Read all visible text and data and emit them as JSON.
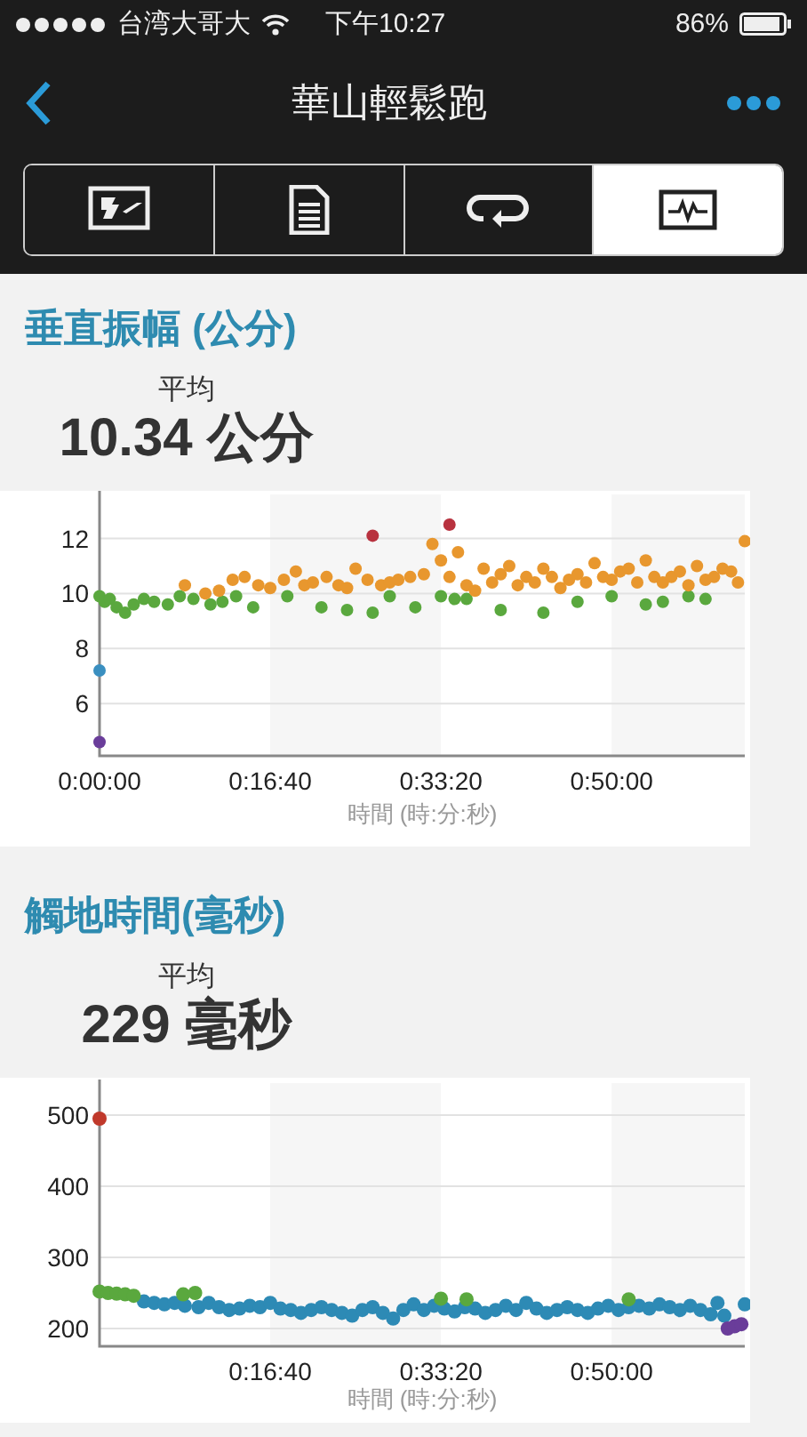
{
  "status_bar": {
    "carrier": "台湾大哥大",
    "time": "下午10:27",
    "battery": "86%"
  },
  "nav": {
    "title": "華山輕鬆跑"
  },
  "tabs": [
    {
      "selected": false
    },
    {
      "selected": false
    },
    {
      "selected": false
    },
    {
      "selected": true
    }
  ],
  "sections": [
    {
      "title": "垂直振幅 (公分)",
      "average_label": "平均",
      "average_value": "10.34 公分",
      "chart_data": {
        "type": "scatter",
        "xlabel": "時間 (時:分:秒)",
        "xlim": [
          0,
          3780
        ],
        "ylim": [
          4.1,
          13.6
        ],
        "xticks": [
          {
            "value": 0,
            "label": "0:00:00"
          },
          {
            "value": 1000,
            "label": "0:16:40"
          },
          {
            "value": 2000,
            "label": "0:33:20"
          },
          {
            "value": 3000,
            "label": "0:50:00"
          }
        ],
        "yticks": [
          6,
          8,
          10,
          12
        ],
        "grid": true,
        "series": [
          {
            "color": "#5aa83e",
            "x": [
              0,
              30,
              60,
              100,
              150,
              200,
              260,
              320,
              400,
              470,
              550,
              650,
              720,
              800,
              900,
              1100,
              1300,
              1450,
              1600,
              1700,
              1850,
              2000,
              2080,
              2150,
              2350,
              2600,
              2800,
              3000,
              3200,
              3300,
              3450,
              3550
            ],
            "values": [
              9.9,
              9.7,
              9.8,
              9.5,
              9.3,
              9.6,
              9.8,
              9.7,
              9.6,
              9.9,
              9.8,
              9.6,
              9.7,
              9.9,
              9.5,
              9.9,
              9.5,
              9.4,
              9.3,
              9.9,
              9.5,
              9.9,
              9.8,
              9.8,
              9.4,
              9.3,
              9.7,
              9.9,
              9.6,
              9.7,
              9.9,
              9.8
            ]
          },
          {
            "color": "#e8972e",
            "x": [
              500,
              620,
              700,
              780,
              850,
              930,
              1000,
              1080,
              1150,
              1200,
              1250,
              1330,
              1400,
              1450,
              1500,
              1570,
              1650,
              1700,
              1750,
              1820,
              1900,
              1950,
              2000,
              2050,
              2100,
              2150,
              2200,
              2250,
              2300,
              2350,
              2400,
              2450,
              2500,
              2550,
              2600,
              2650,
              2700,
              2750,
              2800,
              2850,
              2900,
              2950,
              3000,
              3050,
              3100,
              3150,
              3200,
              3250,
              3300,
              3350,
              3400,
              3450,
              3500,
              3550,
              3600,
              3650,
              3700,
              3740,
              3780
            ],
            "values": [
              10.3,
              10.0,
              10.1,
              10.5,
              10.6,
              10.3,
              10.2,
              10.5,
              10.8,
              10.3,
              10.4,
              10.6,
              10.3,
              10.2,
              10.9,
              10.5,
              10.3,
              10.4,
              10.5,
              10.6,
              10.7,
              11.8,
              11.2,
              10.6,
              11.5,
              10.3,
              10.1,
              10.9,
              10.4,
              10.7,
              11.0,
              10.3,
              10.6,
              10.4,
              10.9,
              10.6,
              10.2,
              10.5,
              10.7,
              10.4,
              11.1,
              10.6,
              10.5,
              10.8,
              10.9,
              10.4,
              11.2,
              10.6,
              10.4,
              10.6,
              10.8,
              10.3,
              11.0,
              10.5,
              10.6,
              10.9,
              10.8,
              10.4,
              11.9
            ]
          },
          {
            "color": "#b8323f",
            "x": [
              1600,
              2050
            ],
            "values": [
              12.1,
              12.5
            ]
          },
          {
            "color": "#3a8fc0",
            "x": [
              0
            ],
            "values": [
              7.2
            ]
          },
          {
            "color": "#6a3d9a",
            "x": [
              0
            ],
            "values": [
              4.6
            ]
          }
        ]
      }
    },
    {
      "title": "觸地時間(毫秒)",
      "average_label": "平均",
      "average_value": "229 毫秒",
      "chart_data": {
        "type": "scatter",
        "xlabel": "時間 (時:分:秒)",
        "xlim": [
          0,
          3780
        ],
        "ylim": [
          175,
          545
        ],
        "xticks": [
          {
            "value": 1000,
            "label": "0:16:40"
          },
          {
            "value": 2000,
            "label": "0:33:20"
          },
          {
            "value": 3000,
            "label": "0:50:00"
          }
        ],
        "yticks": [
          200,
          300,
          400,
          500
        ],
        "grid": true,
        "series": [
          {
            "color": "#2d8ab5",
            "x": [
              260,
              320,
              380,
              440,
              500,
              580,
              640,
              700,
              760,
              820,
              880,
              940,
              1000,
              1060,
              1120,
              1180,
              1240,
              1300,
              1360,
              1420,
              1480,
              1540,
              1600,
              1660,
              1720,
              1780,
              1840,
              1900,
              1960,
              2020,
              2080,
              2140,
              2200,
              2260,
              2320,
              2380,
              2440,
              2500,
              2560,
              2620,
              2680,
              2740,
              2800,
              2860,
              2920,
              2980,
              3040,
              3100,
              3160,
              3220,
              3280,
              3340,
              3400,
              3460,
              3520,
              3580,
              3620,
              3660,
              3780
            ],
            "values": [
              238,
              236,
              234,
              236,
              232,
              230,
              236,
              230,
              226,
              228,
              232,
              230,
              236,
              228,
              226,
              222,
              226,
              230,
              226,
              222,
              218,
              226,
              230,
              222,
              214,
              226,
              234,
              226,
              232,
              228,
              224,
              230,
              228,
              222,
              226,
              232,
              226,
              236,
              228,
              222,
              226,
              230,
              226,
              222,
              228,
              232,
              226,
              230,
              232,
              228,
              234,
              230,
              226,
              232,
              226,
              220,
              236,
              218,
              234
            ]
          },
          {
            "color": "#5aa83e",
            "x": [
              0,
              50,
              100,
              150,
              200,
              490,
              560,
              2000,
              2150,
              3100
            ],
            "values": [
              252,
              250,
              249,
              248,
              246,
              248,
              250,
              242,
              241,
              241
            ]
          },
          {
            "color": "#6a3d9a",
            "x": [
              3680,
              3720,
              3760
            ],
            "values": [
              200,
              203,
              206
            ]
          },
          {
            "color": "#c0392b",
            "x": [
              0
            ],
            "values": [
              495
            ]
          }
        ]
      }
    }
  ]
}
